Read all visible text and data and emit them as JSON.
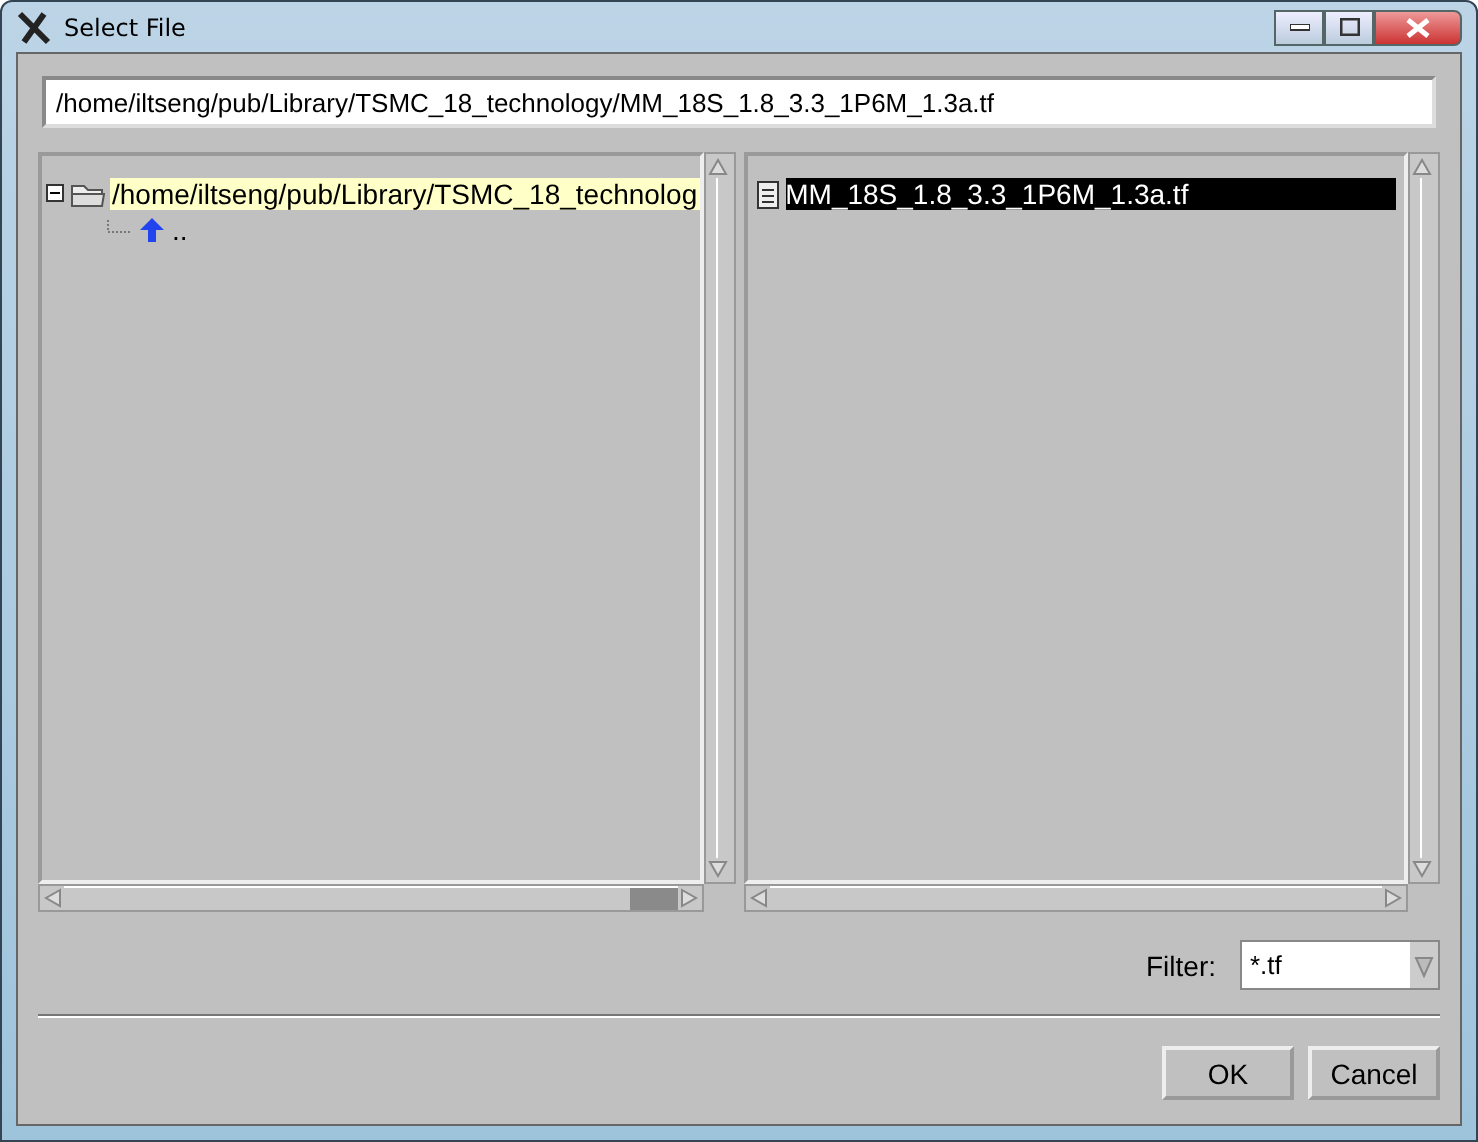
{
  "window": {
    "title": "Select File"
  },
  "path_field": {
    "value": "/home/iltseng/pub/Library/TSMC_18_technology/MM_18S_1.8_3.3_1P6M_1.3a.tf"
  },
  "tree": [
    {
      "label": "/home/iltseng/pub/Library/TSMC_18_technolog",
      "expanded": true,
      "selected": true,
      "children": [
        {
          "label": "..",
          "kind": "parent",
          "selected": false
        }
      ]
    }
  ],
  "files": [
    {
      "name": "MM_18S_1.8_3.3_1P6M_1.3a.tf",
      "selected": true
    }
  ],
  "filter": {
    "label": "Filter:",
    "value": "*.tf"
  },
  "buttons": [
    "OK",
    "Cancel"
  ]
}
